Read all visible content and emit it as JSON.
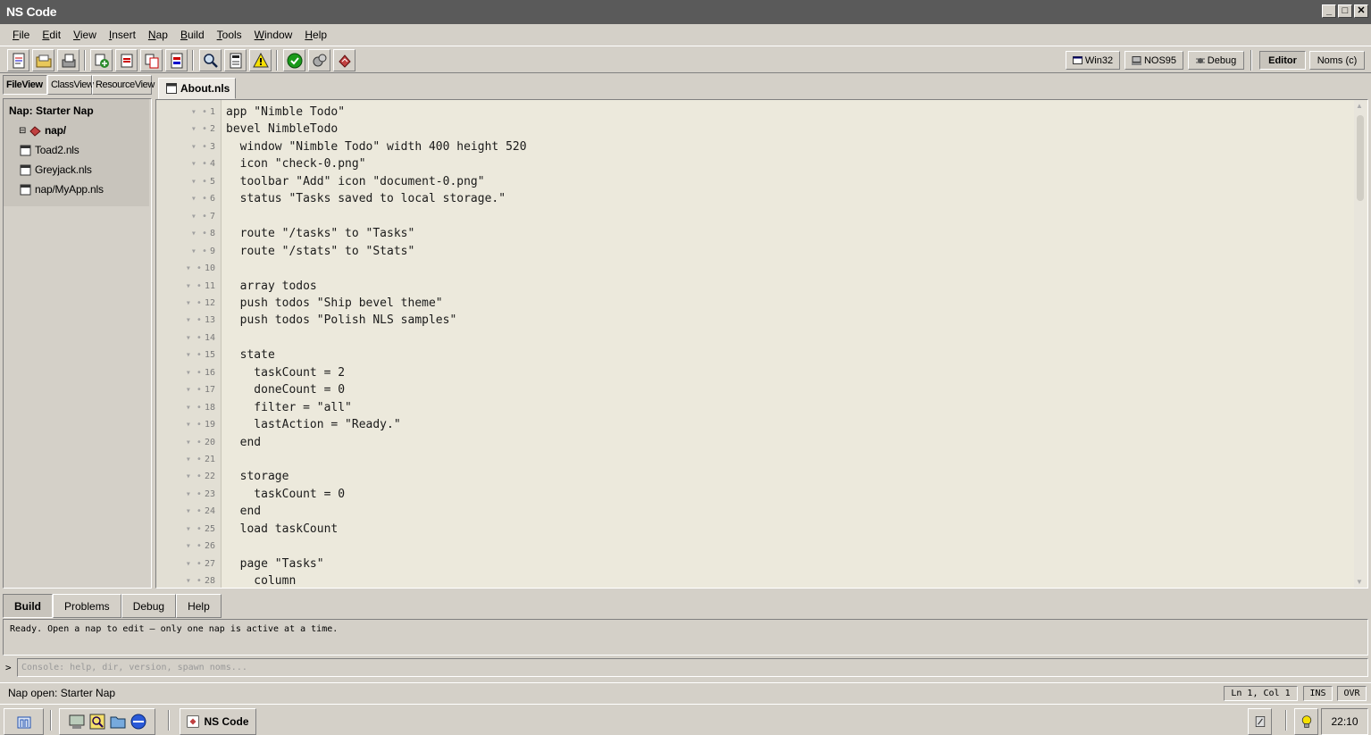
{
  "window": {
    "title": "NS Code"
  },
  "menu": [
    "File",
    "Edit",
    "View",
    "Insert",
    "Nap",
    "Build",
    "Tools",
    "Window",
    "Help"
  ],
  "toolbar": {
    "buttons": [
      {
        "name": "new-file",
        "icon": "new-file-icon"
      },
      {
        "name": "open",
        "icon": "open-folder-icon"
      },
      {
        "name": "save",
        "icon": "save-icon"
      },
      {
        "name": "add-nap",
        "icon": "add-icon"
      },
      {
        "name": "remove",
        "icon": "remove-icon"
      },
      {
        "name": "copy",
        "icon": "copy-icon"
      },
      {
        "name": "properties",
        "icon": "properties-icon"
      },
      {
        "name": "find",
        "icon": "magnifier-icon"
      },
      {
        "name": "document",
        "icon": "document-icon"
      },
      {
        "name": "warning",
        "icon": "warning-icon"
      },
      {
        "name": "run",
        "icon": "check-icon"
      },
      {
        "name": "build",
        "icon": "gears-icon"
      },
      {
        "name": "package",
        "icon": "nap-icon"
      }
    ],
    "targets": [
      {
        "label": "Win32",
        "icon": "window-icon"
      },
      {
        "label": "NOS95",
        "icon": "computer-icon"
      },
      {
        "label": "Debug",
        "icon": "bug-icon"
      }
    ],
    "modes": [
      {
        "label": "Editor",
        "active": true
      },
      {
        "label": "Noms (c)",
        "active": false
      }
    ]
  },
  "left_panel": {
    "tabs": [
      {
        "label": "FileView",
        "active": true
      },
      {
        "label": "ClassView",
        "active": false
      },
      {
        "label": "ResourceView",
        "active": false
      }
    ],
    "tree": {
      "header": "Nap: Starter Nap",
      "folder": "nap/",
      "files": [
        "Toad2.nls",
        "Greyjack.nls",
        "nap/MyApp.nls"
      ]
    }
  },
  "editor": {
    "tab": "About.nls",
    "line_numbers": [
      "1",
      "2",
      "3",
      "4",
      "5",
      "6",
      "7",
      "8",
      "9",
      "10",
      "11",
      "12",
      "13",
      "14",
      "15",
      "16",
      "17",
      "18",
      "19",
      "20",
      "21",
      "22",
      "23",
      "24",
      "25",
      "26",
      "27",
      "28"
    ],
    "lines": [
      "app \"Nimble Todo\"",
      "bevel NimbleTodo",
      "  window \"Nimble Todo\" width 400 height 520",
      "  icon \"check-0.png\"",
      "  toolbar \"Add\" icon \"document-0.png\"",
      "  status \"Tasks saved to local storage.\"",
      "",
      "  route \"/tasks\" to \"Tasks\"",
      "  route \"/stats\" to \"Stats\"",
      "",
      "  array todos",
      "  push todos \"Ship bevel theme\"",
      "  push todos \"Polish NLS samples\"",
      "",
      "  state",
      "    taskCount = 2",
      "    doneCount = 0",
      "    filter = \"all\"",
      "    lastAction = \"Ready.\"",
      "  end",
      "",
      "  storage",
      "    taskCount = 0",
      "  end",
      "  load taskCount",
      "",
      "  page \"Tasks\"",
      "    column"
    ]
  },
  "bottom_panel": {
    "tabs": [
      {
        "label": "Build",
        "active": true
      },
      {
        "label": "Problems",
        "active": false
      },
      {
        "label": "Debug",
        "active": false
      },
      {
        "label": "Help",
        "active": false
      }
    ],
    "output": "Ready. Open a nap to edit — only one nap is active at a time.",
    "console_prompt": ">",
    "console_placeholder": "Console: help, dir, version, spawn noms..."
  },
  "status": {
    "message": "Nap open: Starter Nap",
    "position": "Ln 1, Col 1",
    "ins": "INS",
    "ovr": "OVR"
  },
  "taskbar": {
    "start_icon": "nap-logo-icon",
    "quick_launch": [
      "desktop-icon",
      "explorer-icon",
      "folder-icon",
      "browser-icon"
    ],
    "task": "NS Code",
    "tray": [
      "network-icon",
      "lightbulb-icon"
    ],
    "clock": "22:10"
  }
}
